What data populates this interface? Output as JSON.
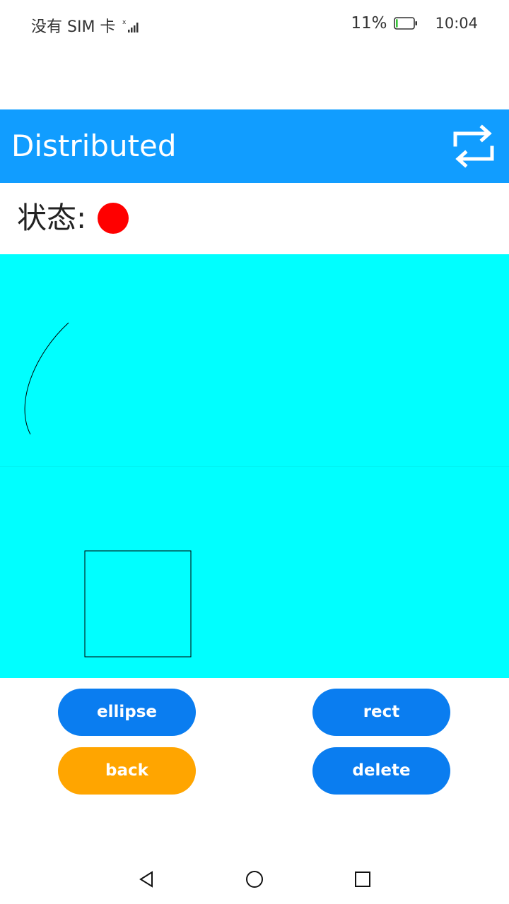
{
  "status_bar": {
    "carrier": "没有 SIM 卡",
    "battery_percent": "11%",
    "battery_level": 0.11,
    "time": "10:04",
    "signal_icon": "signal-icon",
    "battery_icon": "battery-icon"
  },
  "app_bar": {
    "title": "Distributed",
    "swap_icon": "swap-arrows-icon",
    "color": "#119DFF"
  },
  "state": {
    "label": "状态:",
    "indicator_color": "#FF0000"
  },
  "canvas": {
    "background": "#00FFFF",
    "drawn_shapes": [
      "ellipse-arc",
      "rectangle"
    ]
  },
  "buttons": {
    "ellipse": {
      "label": "ellipse",
      "color": "#0A7DF0"
    },
    "rect": {
      "label": "rect",
      "color": "#0A7DF0"
    },
    "back": {
      "label": "back",
      "color": "#FFA500"
    },
    "delete": {
      "label": "delete",
      "color": "#0A7DF0"
    }
  },
  "nav_bar": {
    "back_icon": "triangle-back-icon",
    "home_icon": "circle-home-icon",
    "recents_icon": "square-recents-icon"
  }
}
